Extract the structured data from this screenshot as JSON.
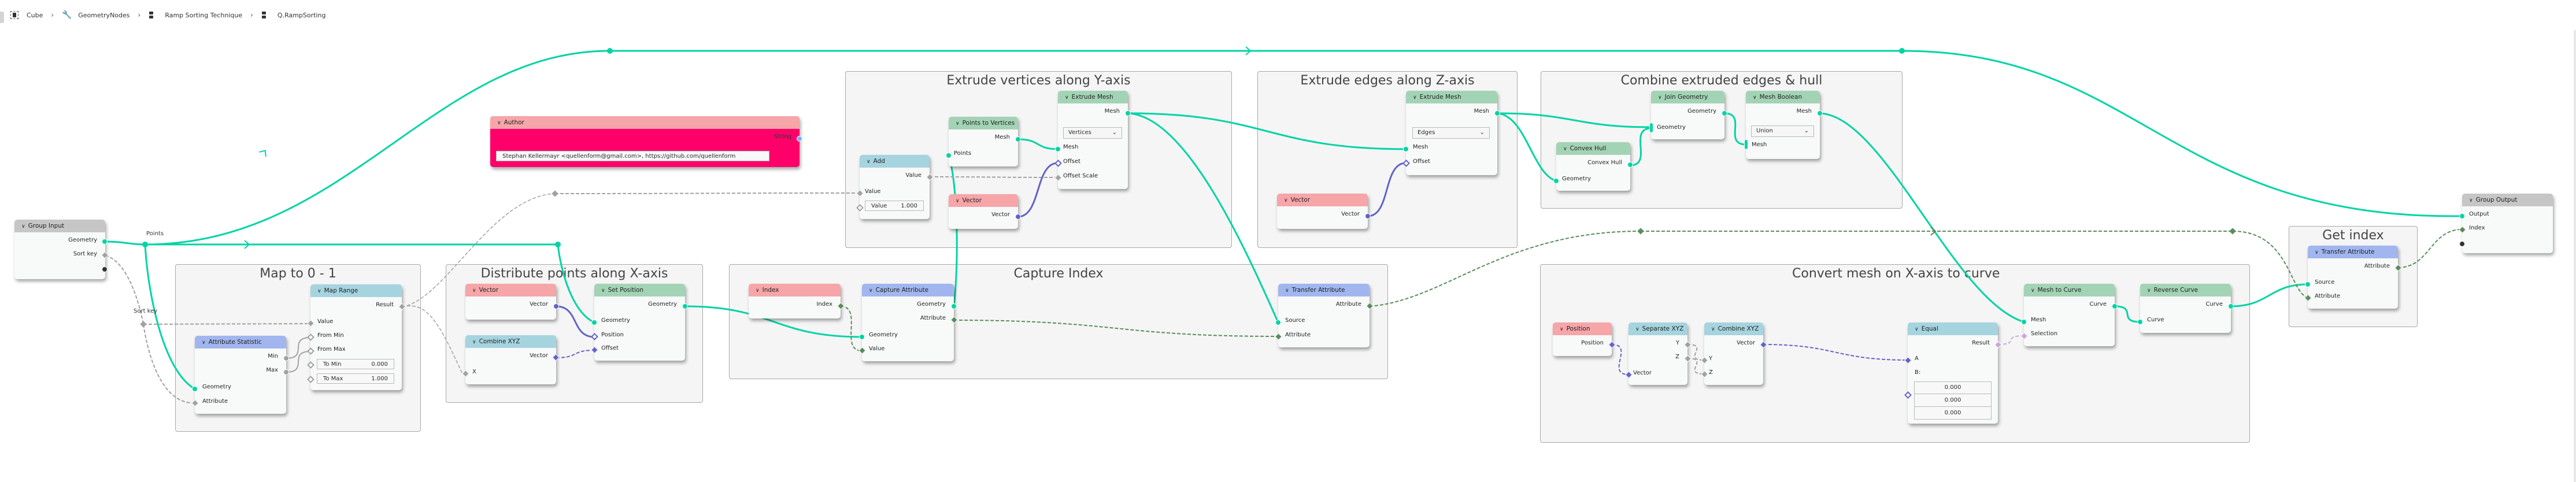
{
  "breadcrumb": [
    {
      "label": "Cube",
      "icon": "mesh-object-icon"
    },
    {
      "label": "GeometryNodes",
      "icon": "wrench-modifier-icon"
    },
    {
      "label": "Ramp Sorting Technique",
      "icon": "node-tree-icon"
    },
    {
      "label": "Q.RampSorting",
      "icon": "node-tree-icon"
    }
  ],
  "colors": {
    "geometry_link": "#00d4a4",
    "vector_socket": "#6363c7",
    "float_socket": "#a1a1a1",
    "int_socket": "#598c5c",
    "bool_socket": "#cca6d6",
    "string_socket": "#70b2ff",
    "author_body": "#ff006a"
  },
  "reroute_labels": {
    "points": "Points",
    "sort_key": "Sort key"
  },
  "frames": {
    "map": "Map to 0 - 1",
    "distribute": "Distribute points along X-axis",
    "extrude_y": "Extrude vertices along Y-axis",
    "capture": "Capture Index",
    "extrude_z": "Extrude edges along Z-axis",
    "combine": "Combine extruded edges & hull",
    "convert": "Convert mesh on X-axis to curve",
    "get_index": "Get index"
  },
  "nodes": {
    "group_input": {
      "title": "Group Input",
      "outputs": [
        "Geometry",
        "Sort key"
      ]
    },
    "attribute_statistic": {
      "title": "Attribute Statistic",
      "outputs": [
        "Min",
        "Max"
      ],
      "inputs": [
        "Geometry",
        "Attribute"
      ]
    },
    "map_range": {
      "title": "Map Range",
      "outputs": [
        "Result"
      ],
      "inputs": [
        "Value",
        "From Min",
        "From Max"
      ],
      "to_min": {
        "label": "To Min",
        "value": "0.000"
      },
      "to_max": {
        "label": "To Max",
        "value": "1.000"
      }
    },
    "author": {
      "title": "Author",
      "output": "String",
      "value": "Stephan Kellermayr <quellenform@gmail.com>, https://github.com/quellenform"
    },
    "vector_1": {
      "title": "Vector",
      "output": "Vector"
    },
    "combine_xyz_1": {
      "title": "Combine XYZ",
      "output": "Vector",
      "input": "X"
    },
    "set_position": {
      "title": "Set Position",
      "output": "Geometry",
      "inputs": [
        "Geometry",
        "Position",
        "Offset"
      ]
    },
    "add": {
      "title": "Add",
      "output": "Value",
      "input": "Value",
      "field": {
        "label": "Value",
        "value": "1.000"
      }
    },
    "points_to_vertices": {
      "title": "Points to Vertices",
      "output": "Mesh",
      "input": "Points"
    },
    "vector_2": {
      "title": "Vector",
      "output": "Vector"
    },
    "extrude_mesh_1": {
      "title": "Extrude Mesh",
      "output": "Mesh",
      "mode": "Vertices",
      "inputs": [
        "Mesh",
        "Offset",
        "Offset Scale"
      ]
    },
    "index": {
      "title": "Index",
      "output": "Index"
    },
    "capture_attribute": {
      "title": "Capture Attribute",
      "outputs": [
        "Geometry",
        "Attribute"
      ],
      "inputs": [
        "Geometry",
        "Value"
      ]
    },
    "transfer_attribute_1": {
      "title": "Transfer Attribute",
      "output": "Attribute",
      "inputs": [
        "Source",
        "Attribute"
      ]
    },
    "extrude_mesh_2": {
      "title": "Extrude Mesh",
      "output": "Mesh",
      "mode": "Edges",
      "inputs": [
        "Mesh",
        "Offset"
      ]
    },
    "vector_3": {
      "title": "Vector",
      "output": "Vector"
    },
    "join_geometry": {
      "title": "Join Geometry",
      "output": "Geometry",
      "input": "Geometry"
    },
    "convex_hull": {
      "title": "Convex Hull",
      "output": "Convex Hull",
      "input": "Geometry"
    },
    "mesh_boolean": {
      "title": "Mesh Boolean",
      "output": "Mesh",
      "mode": "Union",
      "input": "Mesh"
    },
    "position": {
      "title": "Position",
      "output": "Position"
    },
    "separate_xyz": {
      "title": "Separate XYZ",
      "outputs": [
        "Y",
        "Z"
      ],
      "input": "Vector"
    },
    "combine_xyz_2": {
      "title": "Combine XYZ",
      "output": "Vector",
      "inputs": [
        "Y",
        "Z"
      ]
    },
    "equal": {
      "title": "Equal",
      "output": "Result",
      "input_a": "A",
      "input_b": "B:",
      "b_values": [
        "0.000",
        "0.000",
        "0.000"
      ]
    },
    "mesh_to_curve": {
      "title": "Mesh to Curve",
      "output": "Curve",
      "inputs": [
        "Mesh",
        "Selection"
      ]
    },
    "reverse_curve": {
      "title": "Reverse Curve",
      "output": "Curve",
      "input": "Curve"
    },
    "transfer_attribute_2": {
      "title": "Transfer Attribute",
      "output": "Attribute",
      "inputs": [
        "Source",
        "Attribute"
      ]
    },
    "group_output": {
      "title": "Group Output",
      "inputs": [
        "Output",
        "Index"
      ]
    }
  }
}
